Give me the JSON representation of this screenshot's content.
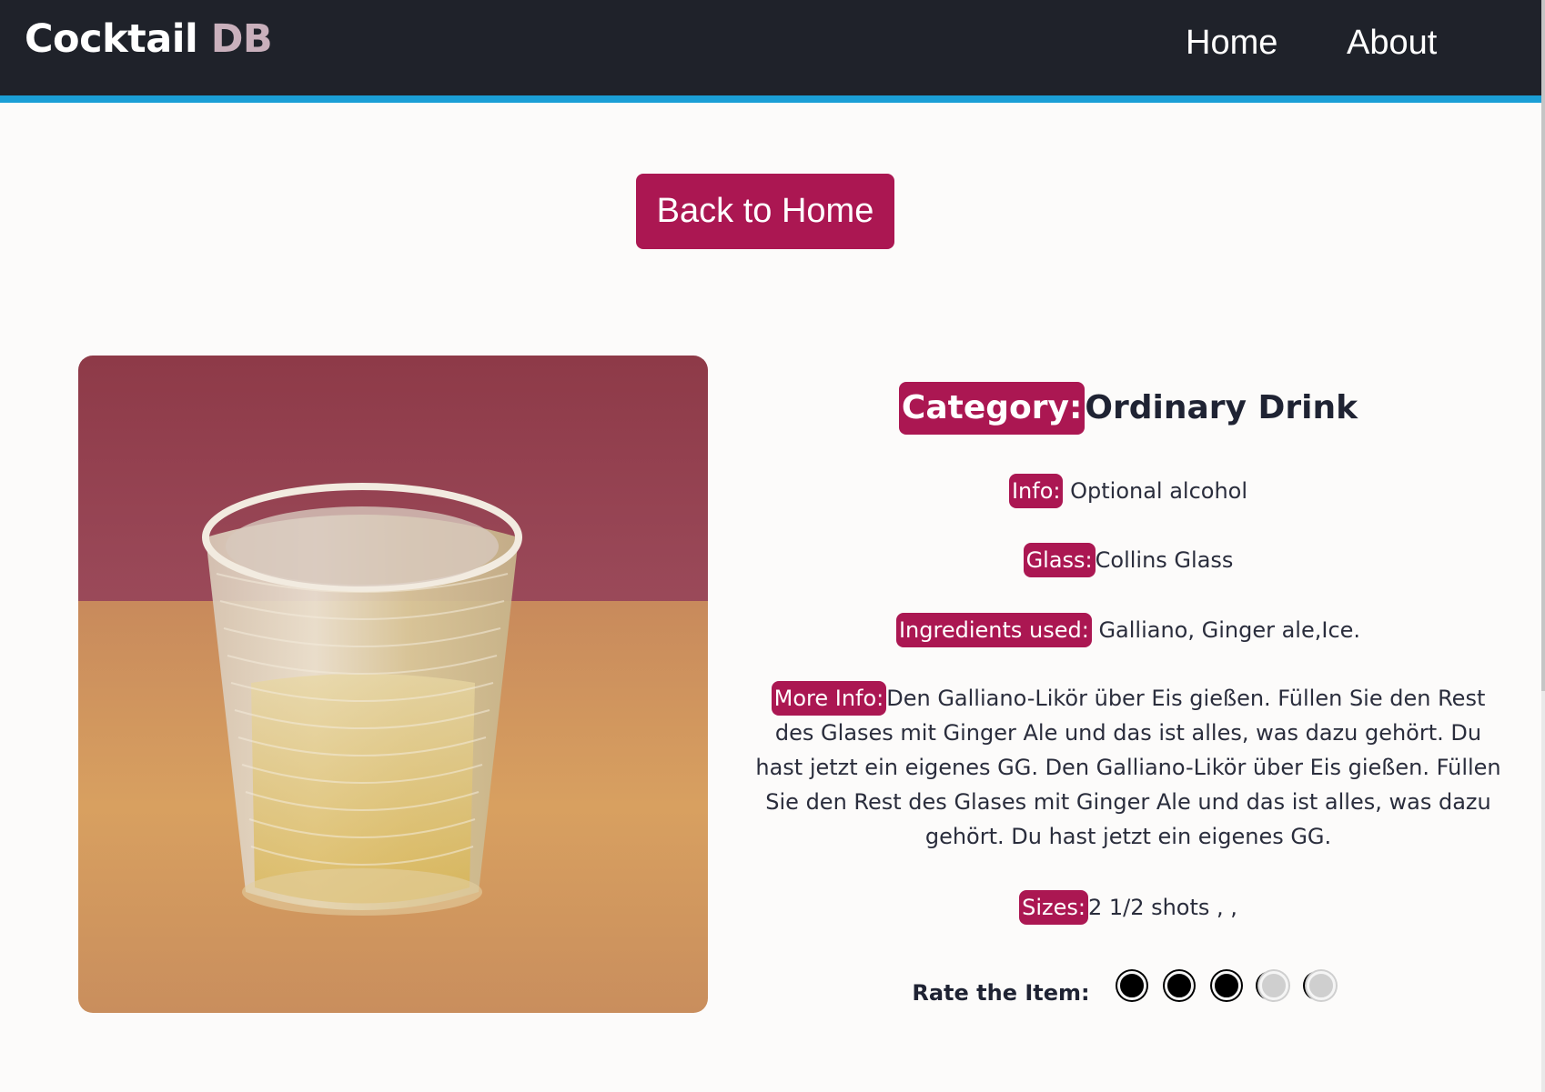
{
  "nav": {
    "brand_main": "Cocktail",
    "brand_accent": "DB",
    "links": [
      "Home",
      "About"
    ]
  },
  "back_button": "Back to Home",
  "drink": {
    "category_label": "Category:",
    "category_value": "Ordinary Drink",
    "info_label": "Info:",
    "info_value": "Optional alcohol",
    "glass_label": "Glass:",
    "glass_value": "Collins Glass",
    "ingredients_label": "Ingredients used:",
    "ingredients_value": "Galliano, Ginger ale,Ice.",
    "more_label": "More Info:",
    "more_value": "Den Galliano-Likör über Eis gießen. Füllen Sie den Rest des Glases mit Ginger Ale und das ist alles, was dazu gehört. Du hast jetzt ein eigenes GG. Den Galliano-Likör über Eis gießen. Füllen Sie den Rest des Glases mit Ginger Ale und das ist alles, was dazu gehört. Du hast jetzt ein eigenes GG.",
    "sizes_label": "Sizes:",
    "sizes_value": "2 1/2 shots , ,"
  },
  "rating": {
    "label": "Rate the Item:",
    "value": 3,
    "max": 5
  },
  "colors": {
    "accent": "#ab1752",
    "navbar": "#1f222a",
    "navbar_border": "#1b9fd6"
  }
}
